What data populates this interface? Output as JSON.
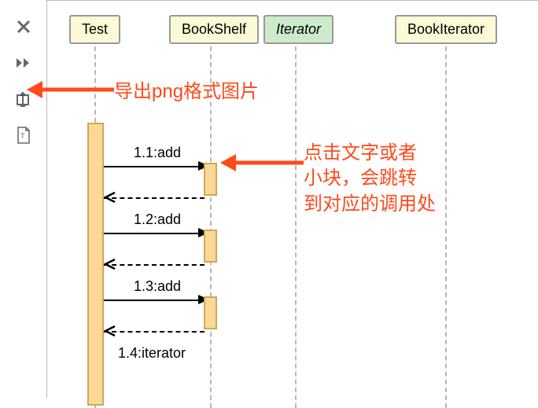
{
  "toolbar": {
    "close": "close",
    "run": "run",
    "export": "export",
    "textfile": "textfile"
  },
  "participants": {
    "test": "Test",
    "bookshelf": "BookShelf",
    "iterator": "Iterator",
    "bookiterator": "BookIterator"
  },
  "messages": {
    "m1": "1.1:add",
    "m2": "1.2:add",
    "m3": "1.3:add",
    "m4": "1.4:iterator"
  },
  "annotations": {
    "export": "导出png格式图片",
    "jump": "点击文字或者\n小块，会跳转\n到对应的调用处"
  }
}
